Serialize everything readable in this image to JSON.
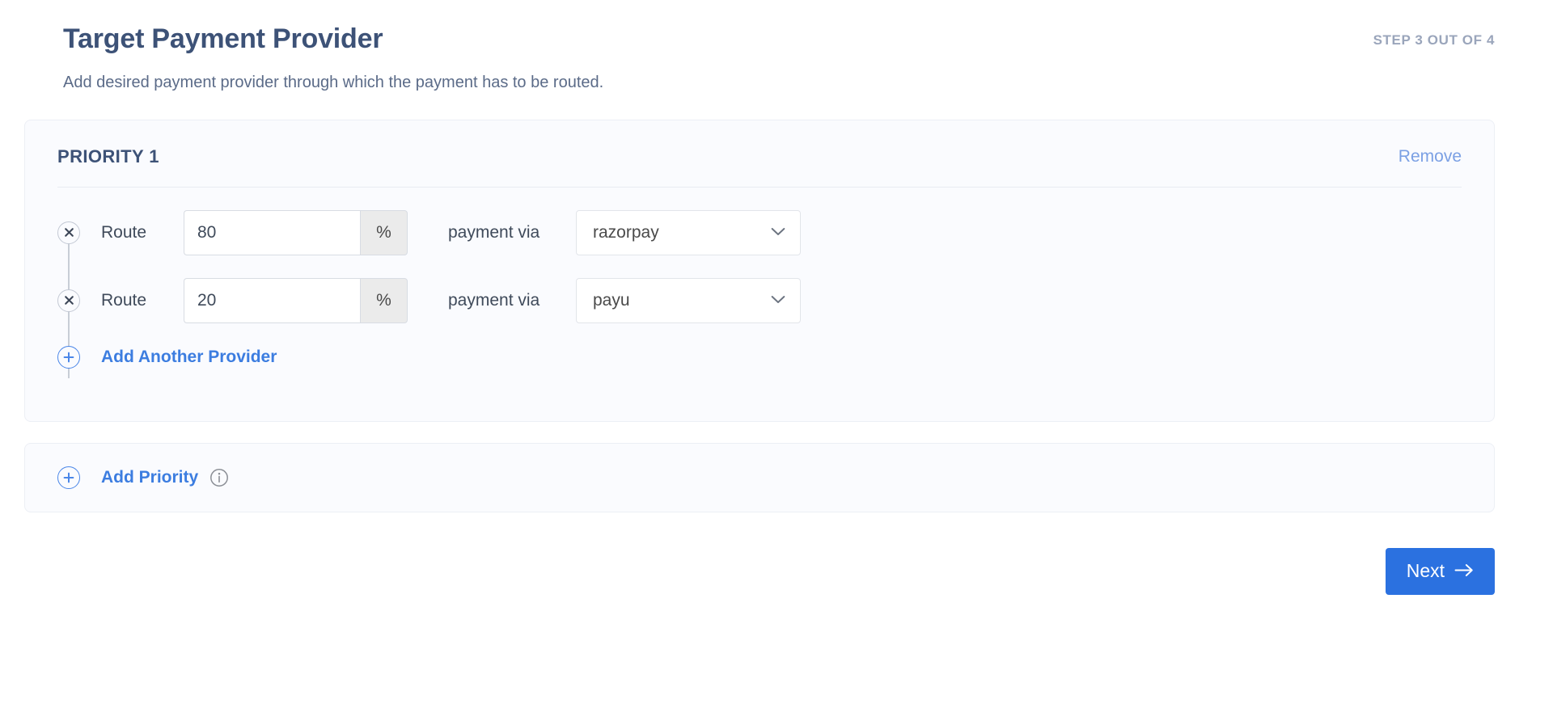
{
  "header": {
    "title": "Target Payment Provider",
    "step": "STEP 3 OUT OF 4",
    "subtitle": "Add desired payment provider through which the payment has to be routed."
  },
  "priority_card": {
    "label": "PRIORITY 1",
    "remove_label": "Remove",
    "routes": [
      {
        "route_label": "Route",
        "value": "80",
        "suffix": "%",
        "via_label": "payment via",
        "provider": "razorpay"
      },
      {
        "route_label": "Route",
        "value": "20",
        "suffix": "%",
        "via_label": "payment via",
        "provider": "payu"
      }
    ],
    "add_provider_label": "Add Another Provider"
  },
  "add_priority_card": {
    "label": "Add Priority"
  },
  "footer": {
    "next_label": "Next",
    "next_arrow": "→"
  },
  "colors": {
    "accent_blue": "#2b71e0",
    "link_blue": "#3c7de0",
    "remove_blue": "#7ba0e4",
    "title_navy": "#3d5277",
    "card_bg": "#fafbfe"
  },
  "icons": {
    "close": "close-icon",
    "plus": "plus-icon",
    "info": "info-icon",
    "chevron": "chevron-down-icon",
    "arrow_right": "arrow-right-icon"
  }
}
